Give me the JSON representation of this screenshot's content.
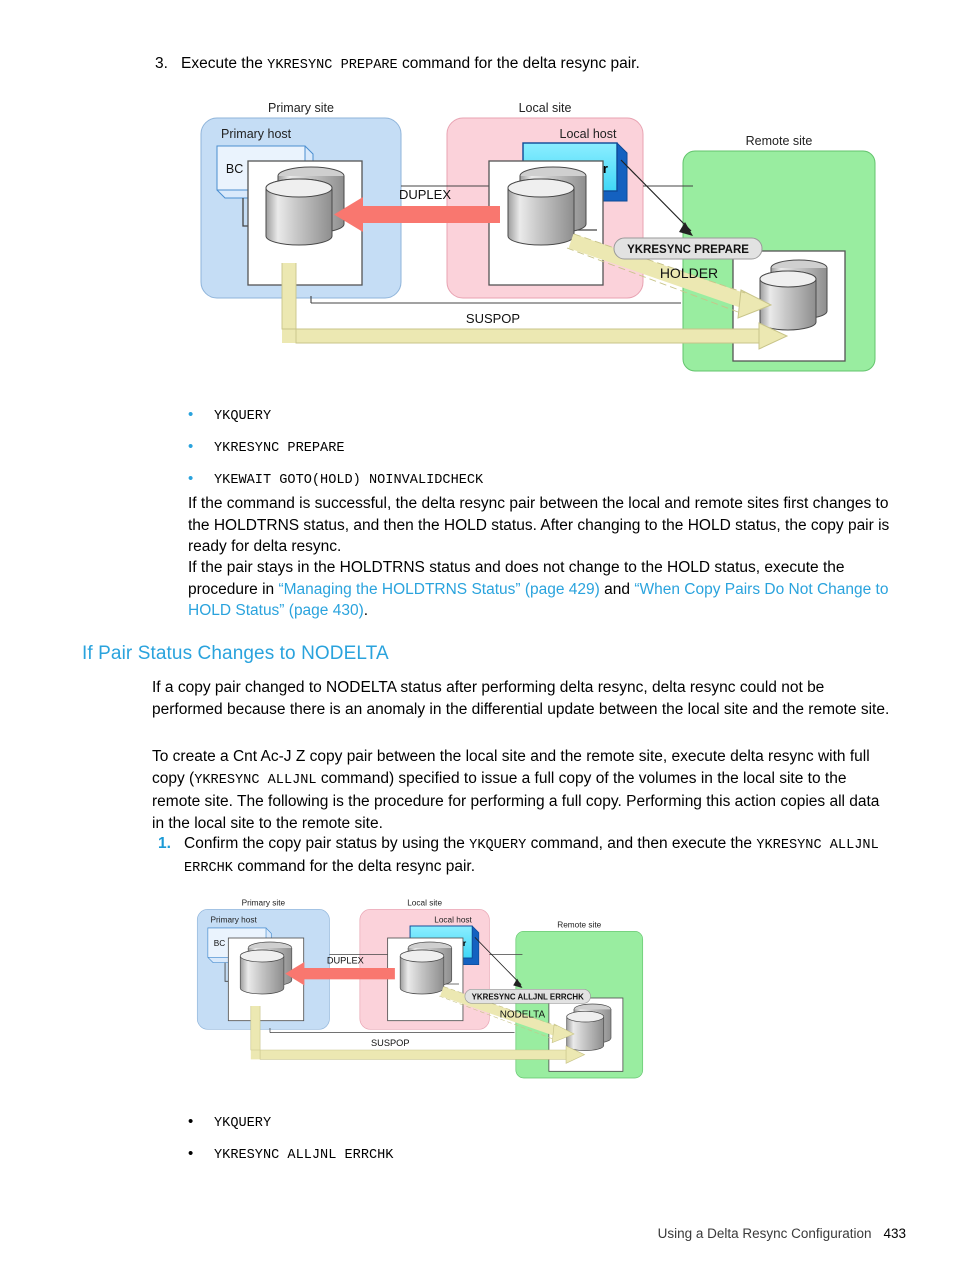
{
  "page": {
    "footer_title": "Using a Delta Resync Configuration",
    "footer_page": "433"
  },
  "step3": {
    "number": "3.",
    "text_before": "Execute the ",
    "command": "YKRESYNC PREPARE",
    "text_after": " command for the delta resync pair."
  },
  "diagram1": {
    "primary_site_label": "Primary site",
    "primary_host_label": "Primary host",
    "primary_bc_manager": "BC Manager",
    "local_site_label": "Local site",
    "local_host_label": "Local host",
    "local_bc_manager": "BC Manager",
    "remote_site_label": "Remote site",
    "duplex_label": "DUPLEX",
    "suspop_label": "SUSPOP",
    "command_label": "YKRESYNC PREPARE",
    "status_label": "HOLDER",
    "colors": {
      "primary_fill": "#c5ddf5",
      "local_fill": "#fbd2da",
      "remote_fill": "#99eda0",
      "red_arrow": "#f9776f",
      "yellow_arrow": "#ece8b2",
      "bcmanager_fill": "#57e0fb",
      "bcmanager_shadow": "#1461c0",
      "pill_fill": "#e2e2e2"
    }
  },
  "commands1": {
    "bullet_glyph": "•",
    "items": [
      "YKQUERY",
      "YKRESYNC PREPARE",
      "YKEWAIT GOTO(HOLD) NOINVALIDCHECK"
    ]
  },
  "para1": "If the command is successful, the delta resync pair between the local and remote sites first changes to the HOLDTRNS status, and then the HOLD status. After changing to the HOLD status, the copy pair is ready for delta resync.",
  "para2": {
    "lead": "If the pair stays in the HOLDTRNS status and does not change to the HOLD status, execute the procedure in ",
    "link1": "“Managing the HOLDTRNS Status” (page 429)",
    "mid": " and ",
    "link2": "“When Copy Pairs Do Not Change to HOLD Status” (page 430)",
    "tail": "."
  },
  "heading": "If Pair Status Changes to NODELTA",
  "para3": "If a copy pair changed to NODELTA status after performing delta resync, delta resync could not be performed because there is an anomaly in the differential update between the local site and the remote site.",
  "para4": {
    "p1": "To create a Cnt Ac-J Z copy pair between the local site and the remote site, execute delta resync with full copy (",
    "cmd": "YKRESYNC ALLJNL",
    "p2": " command) specified to issue a full copy of the volumes in the local site to the remote site. The following is the procedure for performing a full copy. Performing this action copies all data in the local site to the remote site."
  },
  "step1": {
    "number": "1.",
    "p1": "Confirm the copy pair status by using the ",
    "cmd1": "YKQUERY",
    "p2": " command, and then execute the ",
    "cmd2": "YKRESYNC ALLJNL ERRCHK",
    "p3": " command for the delta resync pair."
  },
  "diagram2": {
    "primary_site_label": "Primary site",
    "primary_host_label": "Primary host",
    "primary_bc_manager": "BC Manager",
    "local_site_label": "Local site",
    "local_host_label": "Local host",
    "local_bc_manager": "BC Manager",
    "remote_site_label": "Remote site",
    "duplex_label": "DUPLEX",
    "suspop_label": "SUSPOP",
    "command_label": "YKRESYNC ALLJNL ERRCHK",
    "status_label": "NODELTA"
  },
  "commands2": {
    "bullet_glyph": "•",
    "items": [
      "YKQUERY",
      "YKRESYNC ALLJNL ERRCHK"
    ]
  }
}
